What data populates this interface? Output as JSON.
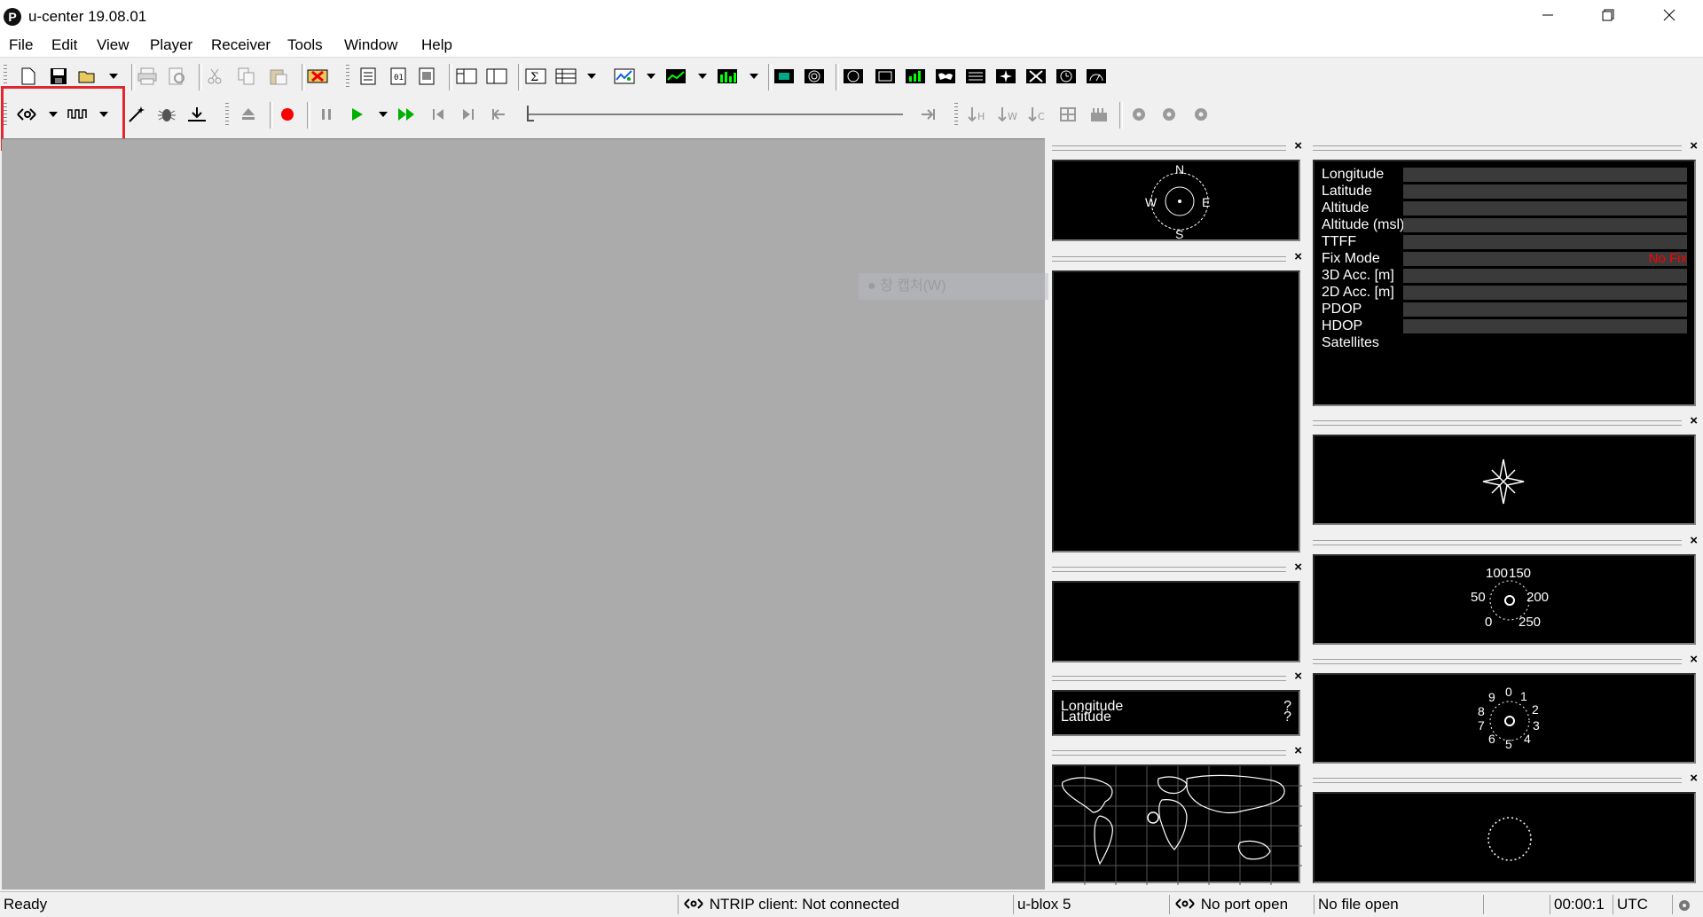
{
  "window": {
    "title": "u-center 19.08.01",
    "icon_letter": "P"
  },
  "menu": [
    "File",
    "Edit",
    "View",
    "Player",
    "Receiver",
    "Tools",
    "Window",
    "Help"
  ],
  "watermark_text": "창 캡처(W)",
  "data_panel": {
    "labels": [
      "Longitude",
      "Latitude",
      "Altitude",
      "Altitude (msl)",
      "TTFF",
      "Fix Mode",
      "3D Acc. [m]",
      "2D Acc. [m]",
      "PDOP",
      "HDOP",
      "Satellites"
    ],
    "fix_value": "No Fix",
    "fix_color": "#ff0000"
  },
  "compass": {
    "n": "N",
    "s": "S",
    "e": "E",
    "w": "W"
  },
  "speed_gauge": {
    "labels": [
      "100",
      "150",
      "50",
      "200",
      "0",
      "250"
    ]
  },
  "clock_gauge": {
    "labels": [
      "0",
      "1",
      "2",
      "3",
      "4",
      "5",
      "6",
      "7",
      "8",
      "9"
    ]
  },
  "position_panel": {
    "longitude_label": "Longitude",
    "latitude_label": "Latitude",
    "longitude_value": "?",
    "latitude_value": "?"
  },
  "statusbar": {
    "ready": "Ready",
    "ntrip": "NTRIP client: Not connected",
    "receiver": "u-blox 5",
    "port": "No port open",
    "file": "No file open",
    "time": "00:00:1",
    "tz": "UTC"
  },
  "colors": {
    "mdi_background": "#ababab",
    "highlight": "#e0282e",
    "play_green": "#00b000",
    "record_red": "#ff0000"
  }
}
